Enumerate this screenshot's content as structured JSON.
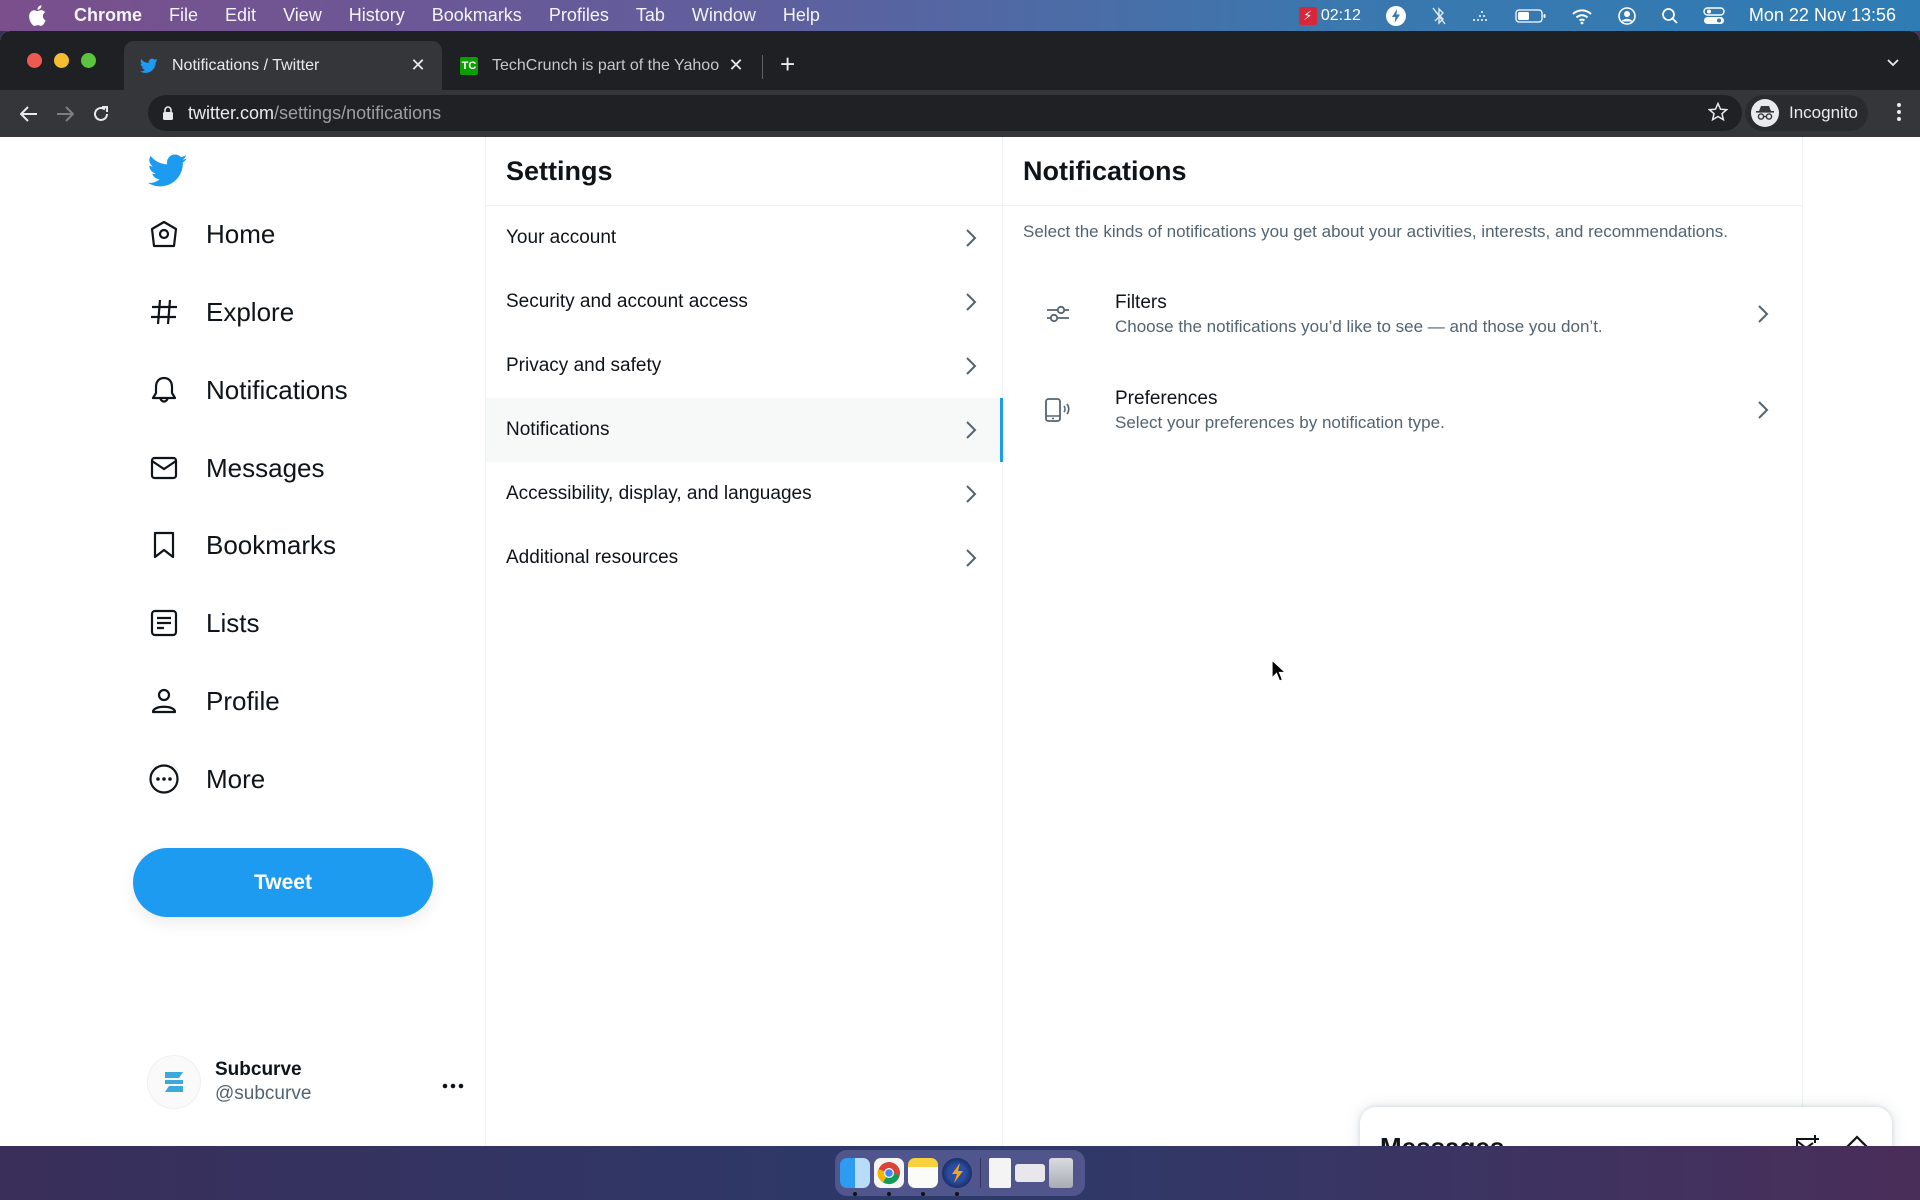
{
  "menubar": {
    "app_name": "Chrome",
    "items": [
      "File",
      "Edit",
      "View",
      "History",
      "Bookmarks",
      "Profiles",
      "Tab",
      "Window",
      "Help"
    ],
    "status": {
      "recording_time": "02:12",
      "clock": "Mon 22 Nov  13:56",
      "icons": [
        "screen-recorder-icon",
        "flash-icon",
        "bluetooth-off-icon",
        "dots-icon",
        "battery-icon",
        "wifi-icon",
        "user-icon",
        "spotlight-search-icon",
        "control-center-icon"
      ]
    }
  },
  "browser": {
    "tabs": [
      {
        "title": "Notifications / Twitter",
        "favicon": "twitter-bird",
        "active": true
      },
      {
        "title": "TechCrunch is part of the Yahoo",
        "favicon": "techcrunch",
        "favicon_text": "TC",
        "active": false
      }
    ],
    "url_host": "twitter.com",
    "url_path": "/settings/notifications",
    "profile_label": "Incognito"
  },
  "twitter": {
    "accent_color": "#1d9bf0",
    "nav": [
      {
        "label": "Home",
        "icon": "home-icon"
      },
      {
        "label": "Explore",
        "icon": "hashtag-icon"
      },
      {
        "label": "Notifications",
        "icon": "bell-icon"
      },
      {
        "label": "Messages",
        "icon": "envelope-icon"
      },
      {
        "label": "Bookmarks",
        "icon": "bookmark-icon"
      },
      {
        "label": "Lists",
        "icon": "list-icon"
      },
      {
        "label": "Profile",
        "icon": "person-icon"
      },
      {
        "label": "More",
        "icon": "more-circle-icon"
      }
    ],
    "tweet_button": "Tweet",
    "account": {
      "display_name": "Subcurve",
      "handle": "@subcurve"
    },
    "settings": {
      "title": "Settings",
      "items": [
        {
          "label": "Your account",
          "active": false
        },
        {
          "label": "Security and account access",
          "active": false
        },
        {
          "label": "Privacy and safety",
          "active": false
        },
        {
          "label": "Notifications",
          "active": true
        },
        {
          "label": "Accessibility, display, and languages",
          "active": false
        },
        {
          "label": "Additional resources",
          "active": false
        }
      ]
    },
    "notifications": {
      "title": "Notifications",
      "description": "Select the kinds of notifications you get about your activities, interests, and recommendations.",
      "items": [
        {
          "title": "Filters",
          "subtitle": "Choose the notifications you’d like to see — and those you don’t.",
          "icon": "sliders-icon"
        },
        {
          "title": "Preferences",
          "subtitle": "Select your preferences by notification type.",
          "icon": "device-notification-icon"
        }
      ]
    },
    "messages_drawer": {
      "title": "Messages"
    }
  },
  "dock": {
    "apps": [
      "Finder",
      "Google Chrome",
      "Notes",
      "Flash app",
      "Document",
      "Screenshot",
      "Trash"
    ]
  }
}
